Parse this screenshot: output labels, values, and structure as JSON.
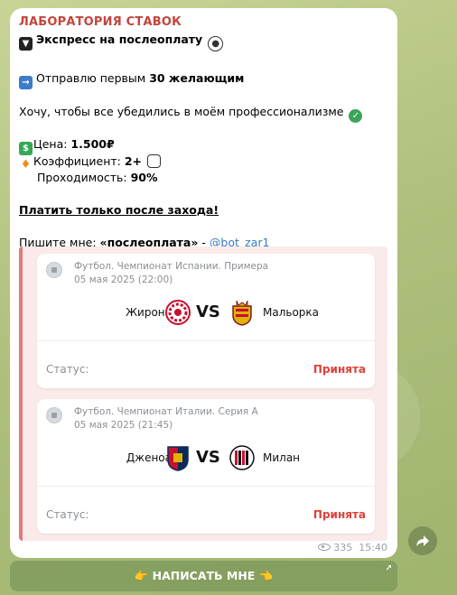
{
  "message": {
    "sender": "ЛАБОРАТОРИЯ СТАВОК",
    "title": "Экспресс на послеоплату",
    "offer_prefix": "Отправлю первым ",
    "offer_bold": "30 желающим",
    "pro_text": "Хочу, чтобы все убедились в моём профессионализме",
    "price_label": "Цена: ",
    "price_value": "1.500₽",
    "coef_label": "Коэффициент: ",
    "coef_value": "2+",
    "pass_label": "Проходимость: ",
    "pass_value": "90%",
    "pay_after": "Платить только после захода!",
    "write_prefix": "Пишите мне: ",
    "write_word": "«послеоплата»",
    "write_dash": " - ",
    "write_handle": "@bot_zar1"
  },
  "matches": [
    {
      "league": "Футбол. Чемпионат Испании. Примера",
      "date": "05 мая 2025 (22:00)",
      "home": "Жирона",
      "vs": "VS",
      "away": "Мальорка",
      "status_label": "Статус:",
      "status_value": "Принята"
    },
    {
      "league": "Футбол. Чемпионат Италии. Серия А",
      "date": "05 мая 2025 (21:45)",
      "home": "Дженоа",
      "vs": "VS",
      "away": "Милан",
      "status_label": "Статус:",
      "status_value": "Принята"
    }
  ],
  "footer": {
    "views": "335",
    "time": "15:40"
  },
  "button": {
    "label": "👉 НАПИСАТЬ МНЕ 👈"
  },
  "colors": {
    "sender": "#c2453b",
    "status": "#e0403a",
    "link": "#3a7bbf"
  }
}
